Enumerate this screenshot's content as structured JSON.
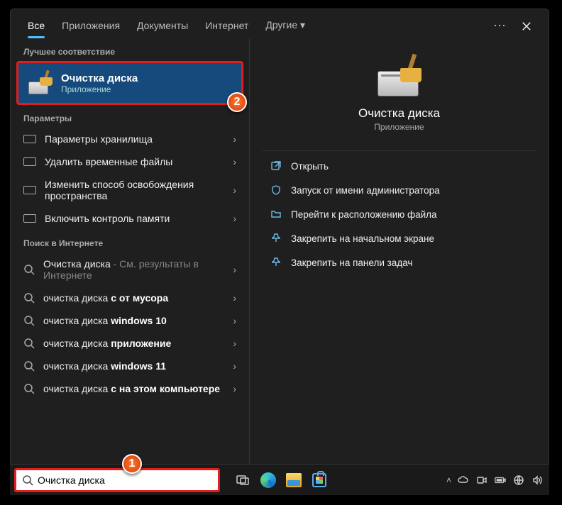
{
  "tabs": [
    "Все",
    "Приложения",
    "Документы",
    "Интернет",
    "Другие"
  ],
  "sections": {
    "best": "Лучшее соответствие",
    "params": "Параметры",
    "web": "Поиск в Интернете"
  },
  "best": {
    "title": "Очистка диска",
    "sub": "Приложение"
  },
  "settings": [
    "Параметры хранилища",
    "Удалить временные файлы",
    "Изменить способ освобождения пространства",
    "Включить контроль памяти"
  ],
  "web_prefix": "Очистка диска",
  "web_dim_suffix": " - См. результаты в Интернете",
  "web": [
    {
      "pre": "очистка диска ",
      "bold": "с от мусора"
    },
    {
      "pre": "очистка диска ",
      "bold": "windows 10"
    },
    {
      "pre": "очистка диска ",
      "bold": "приложение"
    },
    {
      "pre": "очистка диска ",
      "bold": "windows 11"
    },
    {
      "pre": "очистка диска ",
      "bold": "с на этом компьютере"
    }
  ],
  "preview": {
    "title": "Очистка диска",
    "sub": "Приложение"
  },
  "actions": [
    "Открыть",
    "Запуск от имени администратора",
    "Перейти к расположению файла",
    "Закрепить на начальном экране",
    "Закрепить на панели задач"
  ],
  "search_value": "Очистка диска",
  "badges": {
    "one": "1",
    "two": "2"
  }
}
